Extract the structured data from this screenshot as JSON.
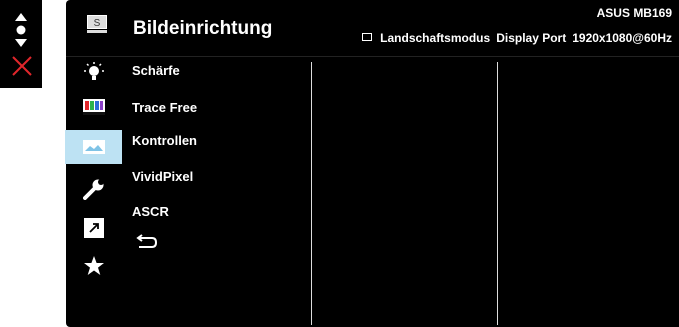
{
  "header": {
    "title": "Bildeinrichtung",
    "model": "ASUS MB169",
    "mode": "Landschaftsmodus",
    "input": "Display Port",
    "resolution": "1920x1080@60Hz"
  },
  "main_menu": [
    {
      "icon": "splendid-icon",
      "active": false
    },
    {
      "icon": "color-icon",
      "active": false
    },
    {
      "icon": "image-icon",
      "active": true
    },
    {
      "icon": "system-setup-icon",
      "active": false
    },
    {
      "icon": "shortcut-icon",
      "active": false
    },
    {
      "icon": "my-favorite-icon",
      "active": false
    }
  ],
  "sub_menu": {
    "items": [
      "Schärfe",
      "Trace Free",
      "Kontrollen",
      "VividPixel",
      "ASCR"
    ],
    "back_icon": "back-icon"
  },
  "side_controls": {
    "nav_icon": "navigate-icon",
    "exit_icon": "exit-x-icon",
    "exit_color": "#e0262b"
  },
  "colors": {
    "background": "#000000",
    "active_highlight": "#bde2f3"
  }
}
